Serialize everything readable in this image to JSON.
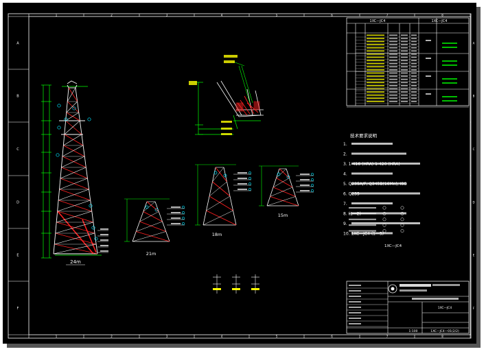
{
  "border": {
    "top_numbers": [
      "1",
      "2",
      "3",
      "4",
      "5",
      "6",
      "7",
      "8"
    ],
    "bottom_numbers": [
      "1",
      "2",
      "3",
      "4",
      "5",
      "6",
      "7",
      "8"
    ],
    "left_letters": [
      "A",
      "B",
      "C",
      "D",
      "E",
      "F"
    ],
    "right_letters": [
      "A",
      "B",
      "C",
      "D",
      "E",
      "F"
    ]
  },
  "drawing": {
    "views": {
      "main_tower_caption": "24m",
      "view2_caption": "21m",
      "view3_caption": "18m",
      "view4_caption": "15m"
    },
    "table": {
      "header_left": "1XC—JC4",
      "header_right": "1XC—JC4"
    },
    "notes_title": "技术要求说明",
    "notes": [
      "1. ",
      "2. ",
      "3. 1-416 (HRA) 1-420 (HRA)",
      "4. ",
      "5. Q235A/F, Q345B(16Mn), ISO",
      "6. Q235",
      "7. ",
      "8. (1—2)",
      "9. ",
      "10. 1XC—JC4  (1—5)"
    ],
    "note_extra": "1XC—JC4",
    "titleblock": {
      "org": "",
      "project": "",
      "drawing_name": "1XC—JC4",
      "drawing_no": "1XC—JC4—01(2/2)",
      "scale": "1:100"
    }
  },
  "colors": {
    "background": "#000000",
    "frame": "#ffffff",
    "tower": "#ffffff",
    "brace_red": "#ff2020",
    "dim_green": "#00ff00",
    "cyan": "#00e5ff",
    "yellow": "#ffff00",
    "magenta": "#ff3cff"
  }
}
